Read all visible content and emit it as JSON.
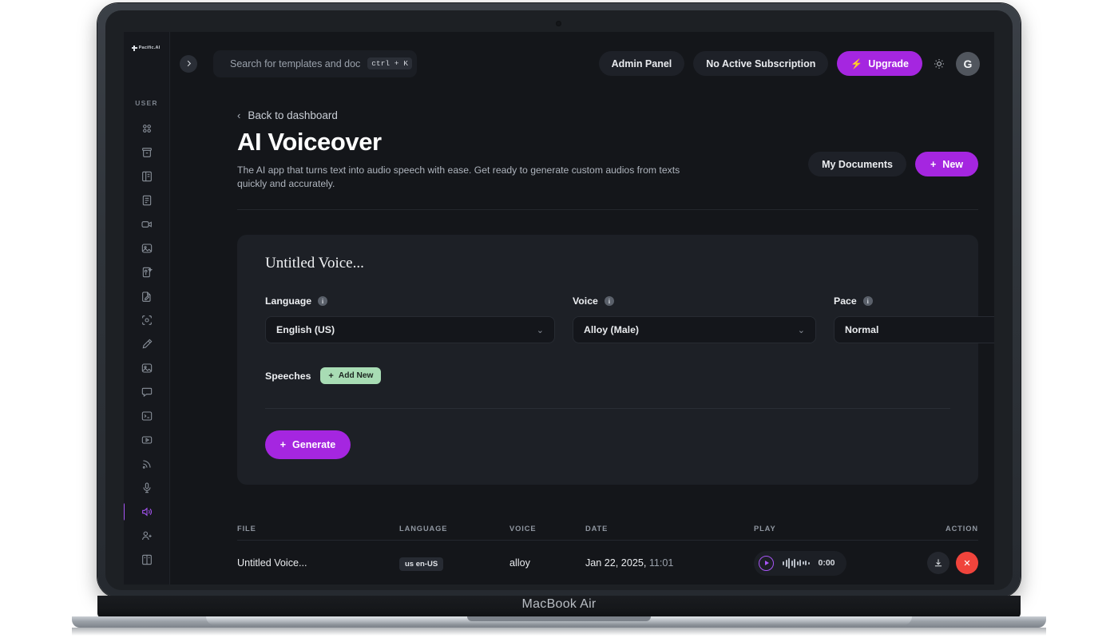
{
  "device": {
    "model_label": "MacBook Air"
  },
  "topbar": {
    "brand": "Pacific.AI",
    "collapse_icon": "chevron-right-icon",
    "search": {
      "icon": "search-icon",
      "placeholder": "Search for templates and doc",
      "shortcut": "ctrl + K"
    },
    "admin_panel_label": "Admin Panel",
    "subscription_label": "No Active Subscription",
    "upgrade_label": "Upgrade",
    "upgrade_icon": "bolt-icon",
    "theme_toggle_icon": "sun-icon",
    "avatar_initial": "G"
  },
  "sidebar": {
    "section_label": "USER",
    "items": [
      {
        "name": "dashboard",
        "icon": "grid-dots-icon",
        "active": false
      },
      {
        "name": "archive",
        "icon": "archive-box-icon",
        "active": false
      },
      {
        "name": "templates",
        "icon": "panel-icon",
        "active": false
      },
      {
        "name": "documents",
        "icon": "document-lines-icon",
        "active": false
      },
      {
        "name": "video",
        "icon": "video-camera-icon",
        "active": false
      },
      {
        "name": "images",
        "icon": "image-icon",
        "active": false
      },
      {
        "name": "ai-detector",
        "icon": "document-sparkle-icon",
        "active": false
      },
      {
        "name": "editor",
        "icon": "document-pencil-icon",
        "active": false
      },
      {
        "name": "vision",
        "icon": "scan-eye-icon",
        "active": false
      },
      {
        "name": "pen",
        "icon": "pen-icon",
        "active": false
      },
      {
        "name": "photo-studio",
        "icon": "photo-icon",
        "active": false
      },
      {
        "name": "chat",
        "icon": "chat-bubble-icon",
        "active": false
      },
      {
        "name": "code",
        "icon": "terminal-icon",
        "active": false
      },
      {
        "name": "player",
        "icon": "play-box-icon",
        "active": false
      },
      {
        "name": "rss",
        "icon": "rss-icon",
        "active": false
      },
      {
        "name": "speech-to-text",
        "icon": "microphone-icon",
        "active": false
      },
      {
        "name": "ai-voiceover",
        "icon": "speaker-wave-icon",
        "active": true
      },
      {
        "name": "team",
        "icon": "user-plus-icon",
        "active": false
      },
      {
        "name": "library",
        "icon": "book-icon",
        "active": false
      }
    ]
  },
  "hero": {
    "back_label": "Back to dashboard",
    "back_icon": "chevron-left-icon",
    "title": "AI Voiceover",
    "description": "The AI app that turns text into audio speech with ease. Get ready to generate custom audios from texts quickly and accurately.",
    "my_documents_label": "My Documents",
    "new_label": "New",
    "new_icon": "plus-icon"
  },
  "card": {
    "title": "Untitled Voice...",
    "fields": [
      {
        "label": "Language",
        "value": "English (US)",
        "info_icon": "info-icon",
        "caret_icon": "chevron-down-icon"
      },
      {
        "label": "Voice",
        "value": "Alloy (Male)",
        "info_icon": "info-icon",
        "caret_icon": "chevron-down-icon"
      },
      {
        "label": "Pace",
        "value": "Normal",
        "info_icon": "info-icon",
        "caret_icon": "chevron-down-icon"
      }
    ],
    "speeches_label": "Speeches",
    "add_new_label": "Add New",
    "add_new_icon": "plus-icon",
    "generate_label": "Generate",
    "generate_icon": "plus-icon"
  },
  "table": {
    "columns": [
      "FILE",
      "LANGUAGE",
      "VOICE",
      "DATE",
      "PLAY",
      "ACTION"
    ],
    "rows": [
      {
        "file": "Untitled Voice...",
        "language": "us en-US",
        "voice": "alloy",
        "date": "Jan 22, 2025,",
        "time": "11:01",
        "play_time": "0:00",
        "play_icon": "play-circle-icon",
        "waveform_icon": "waveform-icon",
        "download_icon": "download-icon",
        "delete_icon": "close-x-icon"
      }
    ]
  },
  "colors": {
    "accent_purple": "#a526e0",
    "active_nav": "#a855f7",
    "danger_red": "#f0443c",
    "add_new_green": "#a8dcb4",
    "page_bg": "#14161a",
    "card_bg": "#1d2026"
  }
}
